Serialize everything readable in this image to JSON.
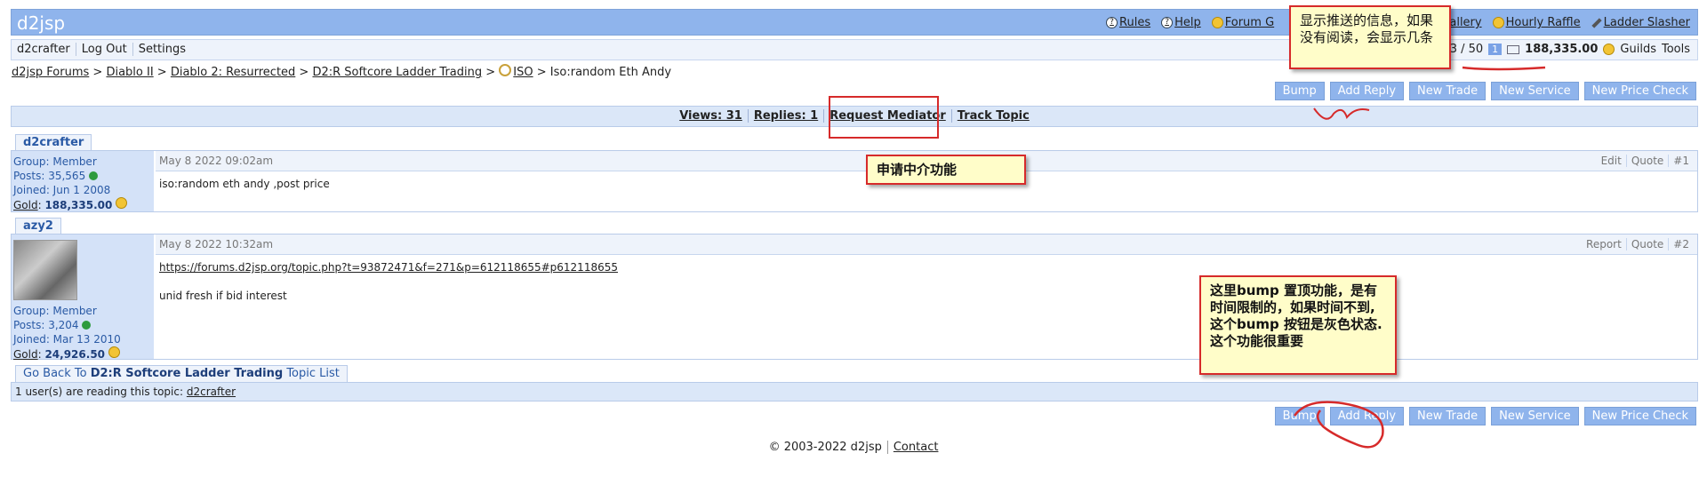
{
  "header": {
    "logo": "d2jsp",
    "nav": [
      {
        "label": "Rules",
        "icon": "help-icon"
      },
      {
        "label": "Help",
        "icon": "help-icon"
      },
      {
        "label": "Forum G",
        "icon": "coin-icon"
      },
      {
        "label": "oto Gallery",
        "icon": "none"
      },
      {
        "label": "Hourly Raffle",
        "icon": "coin-icon"
      },
      {
        "label": "Ladder Slasher",
        "icon": "sword-icon"
      }
    ]
  },
  "userbar": {
    "items": [
      "d2crafter",
      "Log Out",
      "Settings"
    ],
    "pm_count": "3 / 50",
    "pm_new": "1",
    "gold": "188,335.00",
    "guilds": "Guilds",
    "tools": "Tools"
  },
  "breadcrumb": {
    "items": [
      "d2jsp Forums",
      "Diablo II",
      "Diablo 2: Resurrected",
      "D2:R Softcore Ladder Trading",
      "ISO"
    ],
    "current": "Iso:random Eth Andy"
  },
  "actions": [
    "Bump",
    "Add Reply",
    "New Trade",
    "New Service",
    "New Price Check"
  ],
  "topic_bar": {
    "views": "Views: 31",
    "replies": "Replies: 1",
    "mediator": "Request Mediator",
    "track": "Track Topic"
  },
  "posts": [
    {
      "username": "d2crafter",
      "group": "Group: Member",
      "posts": "Posts: 35,565",
      "joined": "Joined: Jun 1 2008",
      "gold_label": "Gold",
      "gold": "188,335.00",
      "date": "May 8 2022 09:02am",
      "controls": [
        "Edit",
        "Quote",
        "#1"
      ],
      "body": [
        "iso:random eth andy ,post price"
      ]
    },
    {
      "username": "azy2",
      "group": "Group: Member",
      "posts": "Posts: 3,204",
      "joined": "Joined: Mar 13 2010",
      "gold_label": "Gold",
      "gold": "24,926.50",
      "date": "May 8 2022 10:32am",
      "controls": [
        "Report",
        "Quote",
        "#2"
      ],
      "link": "https://forums.d2jsp.org/topic.php?t=93872471&f=271&p=612118655#p612118655",
      "body": [
        "unid fresh if bid interest"
      ]
    }
  ],
  "goback": {
    "prefix": "Go Back To",
    "forum": "D2:R Softcore Ladder Trading",
    "suffix": "Topic List"
  },
  "readers": {
    "text": "1 user(s) are reading this topic:",
    "user": "d2crafter"
  },
  "footer": {
    "copyright": "© 2003-2022 d2jsp",
    "contact": "Contact"
  },
  "annotations": {
    "notice": "显示推送的信息，如果没有阅读，会显示几条",
    "mediator": "申请中介功能",
    "bump": "这里bump 置顶功能，是有时间限制的，如果时间不到,这个bump 按钮是灰色状态.这个功能很重要"
  },
  "colors": {
    "header_blue": "#8fb4ec",
    "annotation_border": "#d62a2a",
    "annotation_bg": "#fffdc9"
  }
}
